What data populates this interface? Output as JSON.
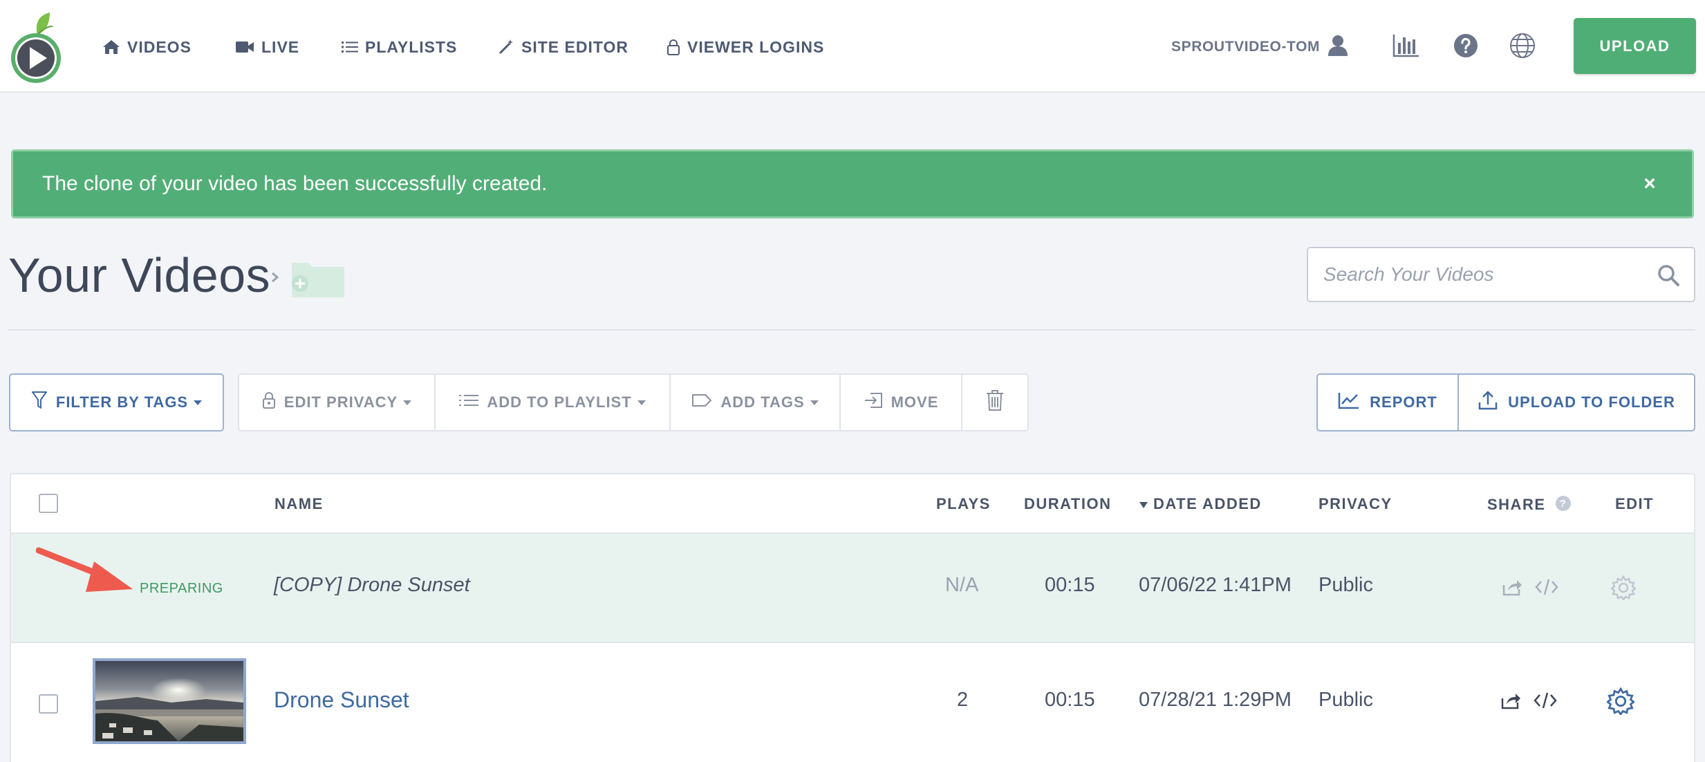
{
  "nav": {
    "items": [
      {
        "label": "VIDEOS",
        "icon": "home-icon"
      },
      {
        "label": "LIVE",
        "icon": "video-camera-icon"
      },
      {
        "label": "PLAYLISTS",
        "icon": "list-icon"
      },
      {
        "label": "SITE EDITOR",
        "icon": "magic-wand-icon"
      },
      {
        "label": "VIEWER LOGINS",
        "icon": "lock-icon"
      }
    ],
    "account_name": "SPROUTVIDEO-TOM",
    "upload_label": "UPLOAD"
  },
  "alert": {
    "message": "The clone of your video has been successfully created.",
    "close_symbol": "×"
  },
  "page": {
    "title": "Your Videos",
    "search_placeholder": "Search Your Videos"
  },
  "toolbar": {
    "filter_label": "FILTER BY TAGS",
    "edit_privacy_label": "EDIT PRIVACY",
    "add_to_playlist_label": "ADD TO PLAYLIST",
    "add_tags_label": "ADD TAGS",
    "move_label": "MOVE",
    "report_label": "REPORT",
    "upload_to_folder_label": "UPLOAD TO FOLDER"
  },
  "table": {
    "columns": {
      "name": "NAME",
      "plays": "PLAYS",
      "duration": "DURATION",
      "date_added": "DATE ADDED",
      "privacy": "PRIVACY",
      "share": "SHARE",
      "edit": "EDIT"
    },
    "rows": [
      {
        "status": "PREPARING",
        "name": "[COPY] Drone Sunset",
        "plays": "N/A",
        "duration": "00:15",
        "date_added": "07/06/22 1:41PM",
        "privacy": "Public"
      },
      {
        "status": "",
        "name": "Drone Sunset",
        "plays": "2",
        "duration": "00:15",
        "date_added": "07/28/21 1:29PM",
        "privacy": "Public"
      }
    ]
  },
  "colors": {
    "brand_green": "#4fae75",
    "link_blue": "#3f69a3",
    "annotation_arrow": "#ee5a4e"
  }
}
